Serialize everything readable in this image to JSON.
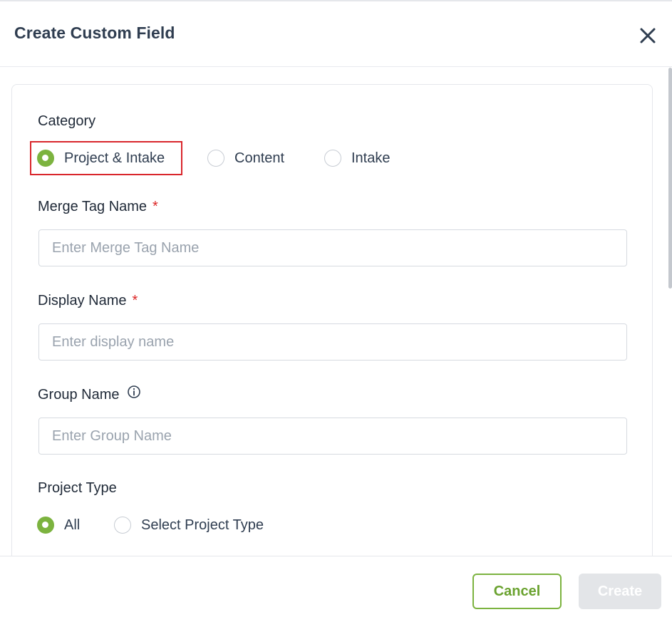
{
  "dialog": {
    "title": "Create Custom Field",
    "close_icon": "close-icon"
  },
  "form": {
    "category": {
      "label": "Category",
      "options": [
        "Project & Intake",
        "Content",
        "Intake"
      ],
      "selected": "Project & Intake"
    },
    "merge_tag": {
      "label": "Merge Tag Name",
      "required_mark": "*",
      "value": "",
      "placeholder": "Enter Merge Tag Name"
    },
    "display_name": {
      "label": "Display Name",
      "required_mark": "*",
      "value": "",
      "placeholder": "Enter display name"
    },
    "group_name": {
      "label": "Group Name",
      "info_icon": "info-icon",
      "value": "",
      "placeholder": "Enter Group Name"
    },
    "project_type": {
      "label": "Project Type",
      "options": [
        "All",
        "Select Project Type"
      ],
      "selected": "All"
    }
  },
  "footer": {
    "cancel_label": "Cancel",
    "create_label": "Create"
  },
  "colors": {
    "accent": "#7cb33f",
    "required": "#dc2626",
    "highlight": "#d9262c",
    "disabled_button": "#e3e5e8"
  }
}
